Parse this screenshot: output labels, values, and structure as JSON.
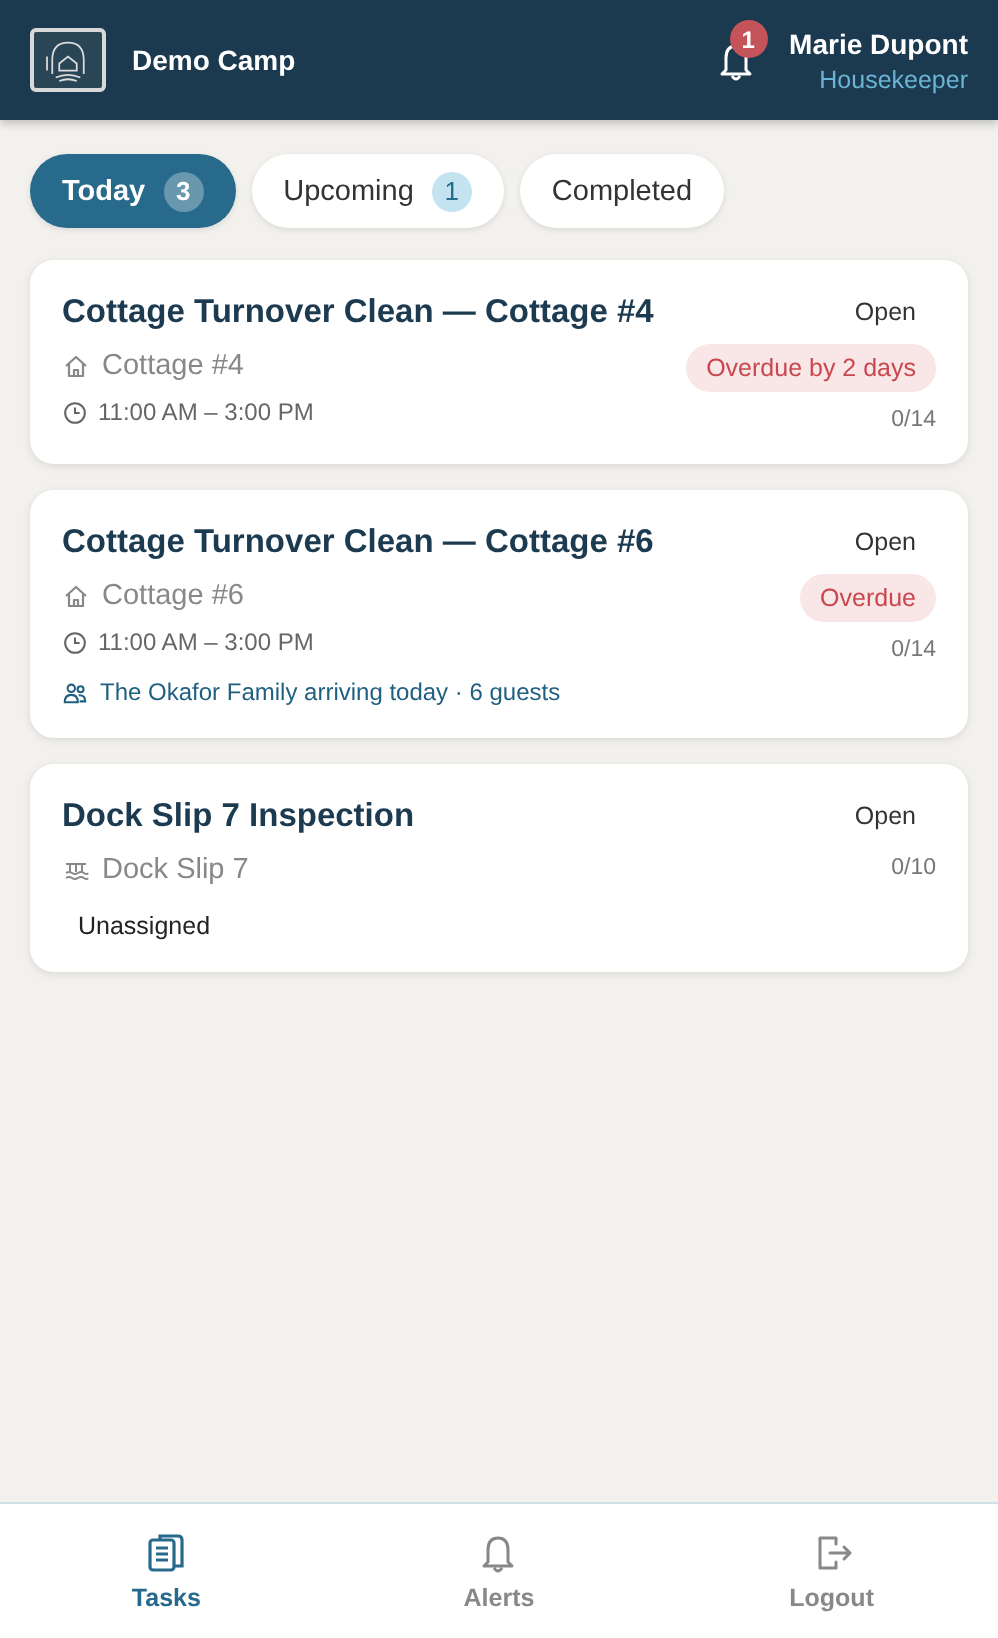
{
  "header": {
    "camp_name": "Demo Camp",
    "notification_count": "1",
    "user_name": "Marie Dupont",
    "user_role": "Housekeeper"
  },
  "tabs": [
    {
      "label": "Today",
      "count": "3",
      "selected": true
    },
    {
      "label": "Upcoming",
      "count": "1",
      "selected": false
    },
    {
      "label": "Completed",
      "selected": false
    }
  ],
  "tasks": [
    {
      "title": "Cottage Turnover Clean — Cottage #4",
      "status": "Open",
      "location": {
        "kind": "cottage",
        "label": "Cottage #4"
      },
      "time": "11:00 AM – 3:00 PM",
      "overdue": "Overdue by 2 days",
      "progress": "0/14"
    },
    {
      "title": "Cottage Turnover Clean — Cottage #6",
      "status": "Open",
      "location": {
        "kind": "cottage",
        "label": "Cottage #6"
      },
      "time": "11:00 AM – 3:00 PM",
      "overdue": "Overdue",
      "progress": "0/14",
      "guest_note": "The Okafor Family arriving today · 6 guests"
    },
    {
      "title": "Dock Slip 7 Inspection",
      "status": "Open",
      "location": {
        "kind": "dock",
        "label": "Dock Slip 7"
      },
      "progress": "0/10",
      "assignee": "Unassigned"
    }
  ],
  "nav": [
    {
      "kind": "tasks",
      "label": "Tasks",
      "selected": true
    },
    {
      "kind": "alerts",
      "label": "Alerts",
      "selected": false
    },
    {
      "kind": "logout",
      "label": "Logout",
      "selected": false
    }
  ]
}
